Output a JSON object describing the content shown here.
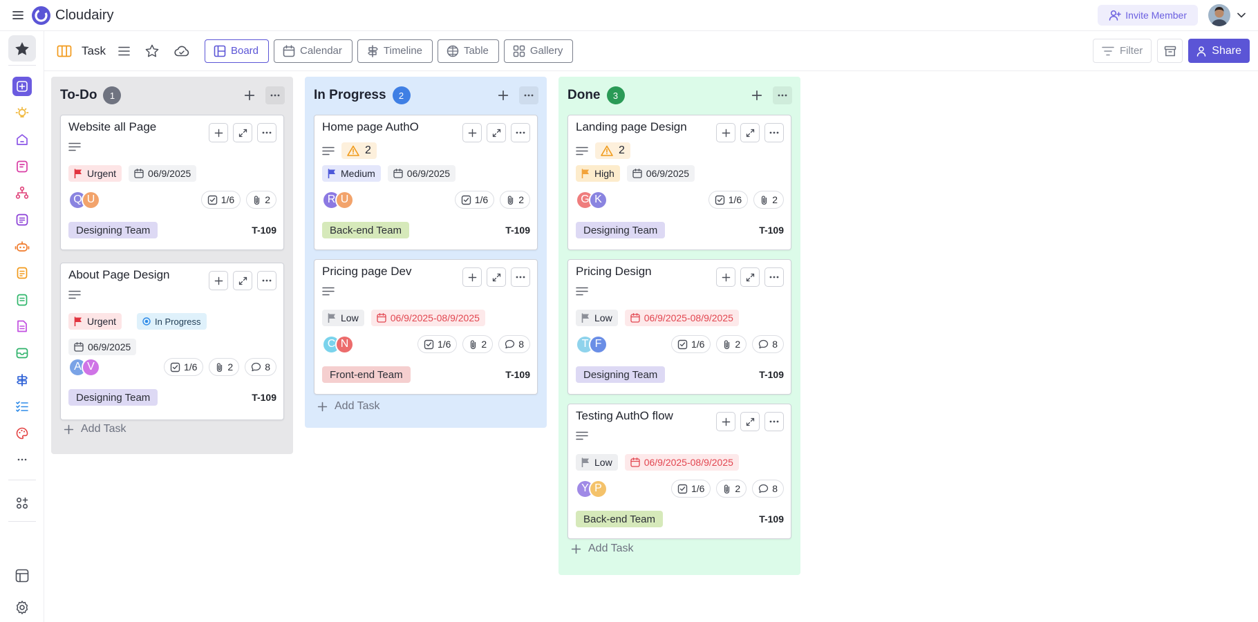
{
  "app": {
    "brand": "Cloudairy"
  },
  "header": {
    "invite_label": "Invite Member"
  },
  "toolbar": {
    "task_label": "Task",
    "views": [
      {
        "label": "Board",
        "icon": "board-icon",
        "active": true
      },
      {
        "label": "Calendar",
        "icon": "calendar-icon",
        "active": false
      },
      {
        "label": "Timeline",
        "icon": "timeline-icon",
        "active": false
      },
      {
        "label": "Table",
        "icon": "table-icon",
        "active": false
      },
      {
        "label": "Gallery",
        "icon": "gallery-icon",
        "active": false
      }
    ],
    "filter_label": "Filter",
    "share_label": "Share"
  },
  "colors": {
    "accent": "#5b55d6",
    "todo_bg": "#e7e7e9",
    "inprogress_bg": "#dbeafc",
    "done_bg": "#dcfbe9",
    "designing_team": "#ddd9f4",
    "backend_team": "#d6e9ba",
    "frontend_team": "#f5cfcf"
  },
  "board": {
    "columns": [
      {
        "title": "To-Do",
        "count": "1",
        "add_task": "Add Task",
        "cards": [
          {
            "title": "Website all Page",
            "priority": "Urgent",
            "date": "06/9/2025",
            "avatars": [
              "Q",
              "U"
            ],
            "checklist": "1/6",
            "attachments": "2",
            "team": "Designing Team",
            "id": "T-109"
          },
          {
            "title": "About Page Design",
            "priority": "Urgent",
            "status": "In Progress",
            "date": "06/9/2025",
            "avatars": [
              "A",
              "V"
            ],
            "checklist": "1/6",
            "attachments": "2",
            "comments": "8",
            "team": "Designing Team",
            "id": "T-109"
          }
        ]
      },
      {
        "title": "In Progress",
        "count": "2",
        "add_task": "Add Task",
        "cards": [
          {
            "title": "Home page AuthO",
            "warnings": "2",
            "priority": "Medium",
            "date": "06/9/2025",
            "avatars": [
              "R",
              "U"
            ],
            "checklist": "1/6",
            "attachments": "2",
            "team": "Back-end Team",
            "id": "T-109"
          },
          {
            "title": "Pricing page Dev",
            "priority": "Low",
            "date": "06/9/2025-08/9/2025",
            "avatars": [
              "C",
              "N"
            ],
            "checklist": "1/6",
            "attachments": "2",
            "comments": "8",
            "team": "Front-end Team",
            "id": "T-109"
          }
        ]
      },
      {
        "title": "Done",
        "count": "3",
        "add_task": "Add Task",
        "cards": [
          {
            "title": "Landing page Design",
            "warnings": "2",
            "priority": "High",
            "date": "06/9/2025",
            "avatars": [
              "G",
              "K"
            ],
            "checklist": "1/6",
            "attachments": "2",
            "team": "Designing Team",
            "id": "T-109"
          },
          {
            "title": "Pricing Design",
            "priority": "Low",
            "date": "06/9/2025-08/9/2025",
            "avatars": [
              "T",
              "F"
            ],
            "checklist": "1/6",
            "attachments": "2",
            "comments": "8",
            "team": "Designing Team",
            "id": "T-109"
          },
          {
            "title": "Testing AuthO flow",
            "priority": "Low",
            "date": "06/9/2025-08/9/2025",
            "avatars": [
              "Y",
              "P"
            ],
            "checklist": "1/6",
            "attachments": "2",
            "comments": "8",
            "team": "Back-end Team",
            "id": "T-109"
          }
        ]
      }
    ]
  }
}
